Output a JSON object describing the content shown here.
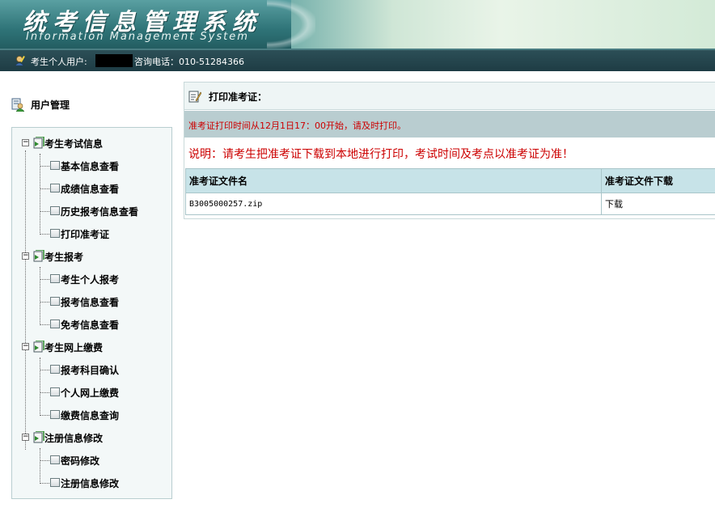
{
  "header": {
    "title_cn": "统考信息管理系统",
    "title_en": "Information Management System"
  },
  "userbar": {
    "user_label": "考生个人用户:",
    "phone_label": "咨询电话：010-51284366"
  },
  "sidebar": {
    "title": "用户管理",
    "groups": [
      {
        "label": "考生考试信息",
        "items": [
          "基本信息查看",
          "成绩信息查看",
          "历史报考信息查看",
          "打印准考证"
        ]
      },
      {
        "label": "考生报考",
        "items": [
          "考生个人报考",
          "报考信息查看",
          "免考信息查看"
        ]
      },
      {
        "label": "考生网上缴费",
        "items": [
          "报考科目确认",
          "个人网上缴费",
          "缴费信息查询"
        ]
      },
      {
        "label": "注册信息修改",
        "items": [
          "密码修改",
          "注册信息修改"
        ]
      }
    ]
  },
  "main": {
    "heading": "打印准考证：",
    "notice": "准考证打印时间从12月1日17：00开始，请及时打印。",
    "explain": "说明：请考生把准考证下载到本地进行打印，考试时间及考点以准考证为准！",
    "table": {
      "columns": [
        "准考证文件名",
        "准考证文件下载"
      ],
      "rows": [
        {
          "filename": "B3005000257.zip",
          "download": "下载"
        }
      ]
    }
  },
  "colors": {
    "header_teal": "#2f7478",
    "userbar_bg": "#1e3c44",
    "notice_text": "#cc0000",
    "table_header_bg": "#c7e3e8",
    "notice_bg": "#b9cdd0"
  },
  "icons": {
    "userbar": "user-pen-icon",
    "sidebar_title": "user-management-icon",
    "group": "folder-doc-icon",
    "leaf": "document-icon",
    "heading": "notepad-pen-icon"
  }
}
